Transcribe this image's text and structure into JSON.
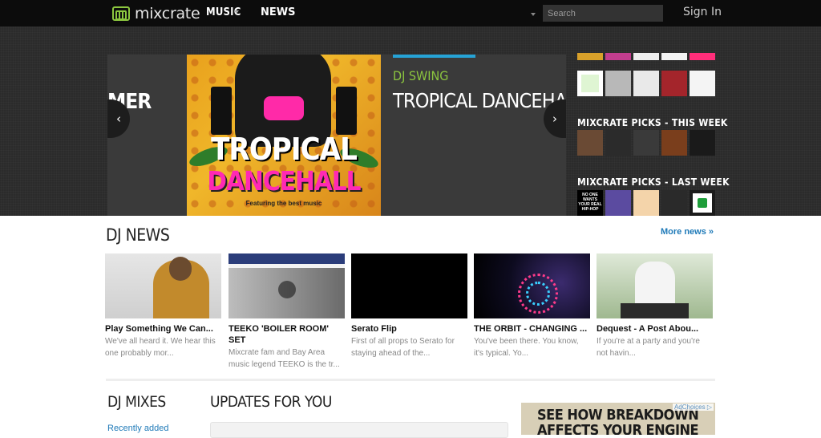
{
  "header": {
    "logo_text": "mixcrate",
    "nav_music": "MUSIC",
    "nav_news": "NEWS",
    "search_placeholder": "Search",
    "sign_in": "Sign In"
  },
  "hero": {
    "prev_slide_text": "MER",
    "slide_image_line1": "TROPICAL",
    "slide_image_line2": "DANCEHALL",
    "slide_image_line3": "Featuring the best music",
    "artist": "DJ SWING",
    "title": "TROPICAL DANCEHALL",
    "prev_arrow": "‹",
    "next_arrow": "›"
  },
  "sidebar": {
    "picks_this_week_title": "MIXCRATE PICKS - THIS WEEK",
    "picks_last_week_title": "MIXCRATE PICKS - LAST WEEK",
    "last_week_first_thumb_text": "NO ONE WANTS YOUR REAL HIP-HOP",
    "row0_colors": [
      "#d8a02a",
      "#c23d8e",
      "#eeeeee",
      "#f3f3f3",
      "#ff2e7a"
    ],
    "row1_colors": [
      "#dff5d3",
      "#b8b8b8",
      "#e9e9e9",
      "#a4252b",
      "#f4f4f4"
    ],
    "this_week_colors": [
      "#6a4a34",
      "#2b2b2b",
      "#3a3a3a",
      "#7a3e1c",
      "#1a1a1a"
    ],
    "last_week_colors": [
      "#000000",
      "#5b4ba0",
      "#f4d4aa",
      "#2a2a2a",
      "#ffffff"
    ]
  },
  "news": {
    "title": "DJ NEWS",
    "more_link": "More news »",
    "items": [
      {
        "headline": "Play Something We Can...",
        "desc": "We've all heard it. We hear this one probably mor..."
      },
      {
        "headline": "TEEKO 'BOILER ROOM' SET",
        "desc": "Mixcrate fam and Bay Area music legend TEEKO is the tr..."
      },
      {
        "headline": "Serato Flip",
        "desc": "First of all props to Serato for staying ahead of the..."
      },
      {
        "headline": "THE ORBIT - CHANGING ...",
        "desc": "You've been there. You know, it's typical. Yo..."
      },
      {
        "headline": "Dequest - A Post Abou...",
        "desc": "If you're at a party and you're not havin..."
      }
    ]
  },
  "mixes": {
    "title": "DJ MIXES",
    "recently_added": "Recently added"
  },
  "updates": {
    "title": "UPDATES FOR YOU"
  },
  "ad": {
    "line1": "SEE HOW BREAKDOWN",
    "line2": "AFFECTS YOUR ENGINE",
    "adchoices": "AdChoices ▷"
  }
}
